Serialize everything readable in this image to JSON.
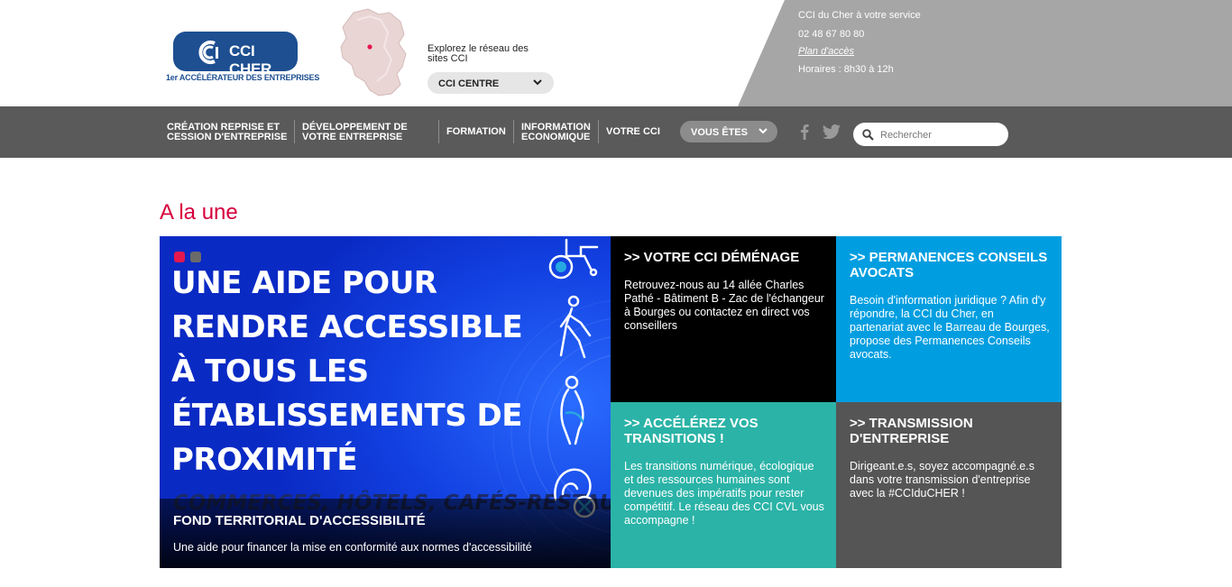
{
  "header": {
    "logo": {
      "name": "CCI CHER",
      "tagline": "1er ACCÉLÉRATEUR DES ENTREPRISES"
    },
    "explore_text": "Explorez le réseau des sites CCI",
    "network_select": "CCI CENTRE",
    "contact": {
      "service": "CCI du Cher à votre service",
      "phone": "02 48 67 80 80",
      "map_link": "Plan d'accès",
      "hours": "Horaires : 8h30 à 12h"
    }
  },
  "nav": {
    "items": [
      {
        "label": "CRÉATION REPRISE ET CESSION D'ENTREPRISE"
      },
      {
        "label": "DÉVELOPPEMENT DE VOTRE ENTREPRISE"
      },
      {
        "label": "FORMATION"
      },
      {
        "label": "INFORMATION ECONOMIQUE"
      },
      {
        "label": "VOTRE CCI"
      }
    ],
    "vous_etes": "VOUS ÊTES",
    "search_placeholder": "Rechercher",
    "social": [
      "facebook-icon",
      "twitter-icon"
    ]
  },
  "main": {
    "section_title": "A la une",
    "slider": {
      "slide_count": 2,
      "active_slide": 1,
      "headline": "UNE AIDE POUR RENDRE ACCESSIBLE À TOUS LES ÉTABLISSEMENTS DE PROXIMITÉ",
      "subline": "COMMERCES, HÔTELS, CAFÉS-RESTAURANTS",
      "caption_title": "FOND TERRITORIAL D'ACCESSIBILITÉ",
      "caption_text": "Une aide pour financer la mise en conformité aux normes d'accessibilité"
    },
    "tiles": [
      {
        "title": ">> VOTRE CCI DÉMÉNAGE",
        "body": "Retrouvez-nous au 14 allée Charles Pathé - Bâtiment B - Zac de l'échangeur à Bourges ou contactez en direct vos conseillers",
        "color": "#000000"
      },
      {
        "title": ">> PERMANENCES CONSEILS AVOCATS",
        "body": "Besoin d'information juridique ? Afin d'y répondre, la CCI du Cher, en partenariat avec le Barreau de Bourges, propose des Permanences Conseils avocats.",
        "color": "#009ee0"
      },
      {
        "title": ">> ACCÉLÉREZ VOS TRANSITIONS !",
        "body": "Les transitions numérique, écologique et des ressources humaines sont devenues des impératifs pour rester compétitif. Le réseau des CCI CVL vous accompagne !",
        "color": "#2bb3a7"
      },
      {
        "title": ">> TRANSMISSION D'ENTREPRISE",
        "body": "Dirigeant.e.s, soyez accompagné.e.s dans votre transmission d'entreprise avec la #CCIduCHER !",
        "color": "#555555"
      }
    ]
  },
  "colors": {
    "brand_blue": "#1d4f91",
    "accent_red": "#d6003c",
    "nav_bg": "#5a5a5a",
    "header_grey": "#a6a6a6"
  }
}
